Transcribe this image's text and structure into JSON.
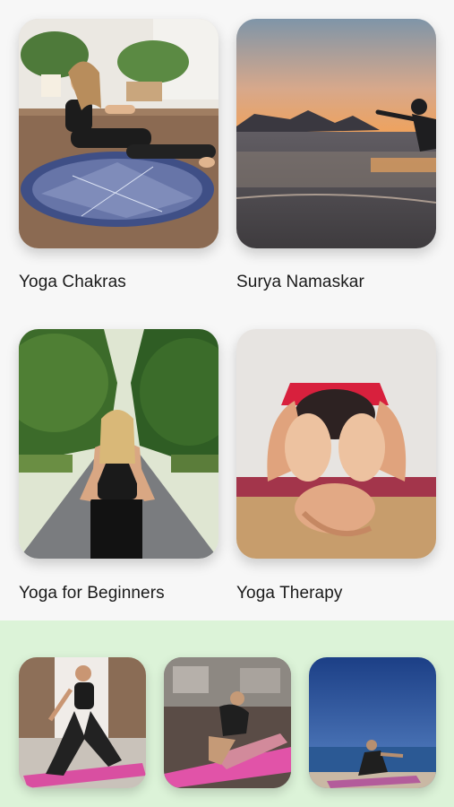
{
  "categories": [
    {
      "label": "Yoga Chakras"
    },
    {
      "label": "Surya Namaskar"
    },
    {
      "label": "Yoga for Beginners"
    },
    {
      "label": "Yoga Therapy"
    }
  ],
  "featured_strip": {
    "background": "#dcf3d8",
    "items": [
      {
        "icon": "yoga-stretch-photo"
      },
      {
        "icon": "yoga-mat-twist-photo"
      },
      {
        "icon": "yoga-seaside-photo"
      }
    ]
  }
}
